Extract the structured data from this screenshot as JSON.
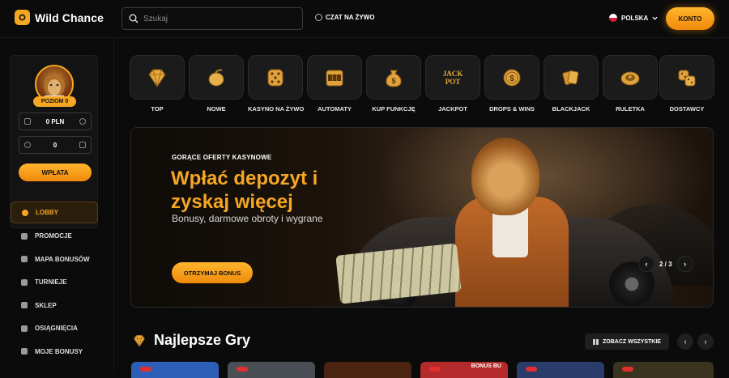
{
  "header": {
    "brand": "Wild Chance",
    "search_placeholder": "Szukaj",
    "live_chat": "CZAT NA ŻYWO",
    "language": "POLSKA",
    "account_button": "KONTO"
  },
  "sidebar": {
    "level": "POZIOM 0",
    "balance": "0 PLN",
    "bonus_balance": "0",
    "deposit_button": "WPŁATA",
    "nav": [
      {
        "label": "LOBBY",
        "icon": "lobby-icon",
        "active": true
      },
      {
        "label": "PROMOCJE",
        "icon": "megaphone-icon"
      },
      {
        "label": "MAPA BONUSÓW",
        "icon": "map-icon"
      },
      {
        "label": "TURNIEJE",
        "icon": "trophy-icon"
      },
      {
        "label": "SKLEP",
        "icon": "shop-icon"
      },
      {
        "label": "OSIĄGNIĘCIA",
        "icon": "achievement-icon"
      },
      {
        "label": "MOJE BONUSY",
        "icon": "gift-icon"
      }
    ]
  },
  "categories": [
    {
      "label": "TOP",
      "icon": "diamond-icon"
    },
    {
      "label": "NOWE",
      "icon": "lemon-icon"
    },
    {
      "label": "KASYNO NA ŻYWO",
      "icon": "dice-icon"
    },
    {
      "label": "AUTOMATY",
      "icon": "slot-machine-icon"
    },
    {
      "label": "KUP FUNKCJĘ",
      "icon": "money-bag-icon"
    },
    {
      "label": "JACKPOT",
      "icon": "jackpot-icon"
    },
    {
      "label": "DROPS & WINS",
      "icon": "coin-icon"
    },
    {
      "label": "BLACKJACK",
      "icon": "cards-icon"
    },
    {
      "label": "RULETKA",
      "icon": "roulette-icon"
    },
    {
      "label": "DOSTAWCY",
      "icon": "dice-pair-icon"
    }
  ],
  "jackpot_icon_text": [
    "JACK",
    "POT"
  ],
  "banner": {
    "kicker": "GORĄCE OFERTY KASYNOWE",
    "title": "Wpłać depozyt i zyskaj więcej",
    "subtitle": "Bonusy, darmowe obroty i wygrane",
    "cta": "OTRZYMAJ BONUS",
    "slide_indicator": "2 / 3"
  },
  "best_games": {
    "title": "Najlepsze Gry",
    "see_all": "ZOBACZ WSZYSTKIE",
    "thumb_tag": "BONUS BU"
  },
  "colors": {
    "accent": "#f5a623",
    "background": "#0b0b0b",
    "tile": "#1b1b1b"
  }
}
